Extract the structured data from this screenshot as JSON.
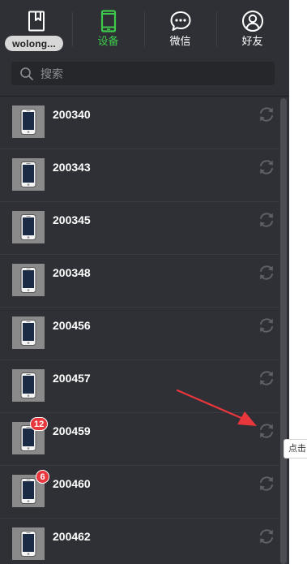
{
  "nav": {
    "items": [
      {
        "label": "",
        "icon": "notebook-icon",
        "active": false
      },
      {
        "label": "设备",
        "icon": "phone-icon",
        "active": true
      },
      {
        "label": "微信",
        "icon": "chat-bubble-icon",
        "active": false
      },
      {
        "label": "好友",
        "icon": "user-icon",
        "active": false
      }
    ],
    "user_name": "wolong..."
  },
  "search": {
    "placeholder": "搜索"
  },
  "devices": [
    {
      "name": "200340",
      "badge": null
    },
    {
      "name": "200343",
      "badge": null
    },
    {
      "name": "200345",
      "badge": null
    },
    {
      "name": "200348",
      "badge": null
    },
    {
      "name": "200456",
      "badge": null
    },
    {
      "name": "200457",
      "badge": null
    },
    {
      "name": "200459",
      "badge": "12"
    },
    {
      "name": "200460",
      "badge": "6"
    },
    {
      "name": "200462",
      "badge": null
    }
  ],
  "tooltip": {
    "text": "点击"
  },
  "colors": {
    "panel_bg": "#2e3035",
    "active_accent": "#3fc94c",
    "badge": "#e8363d",
    "annotation_arrow": "#e8363d"
  }
}
